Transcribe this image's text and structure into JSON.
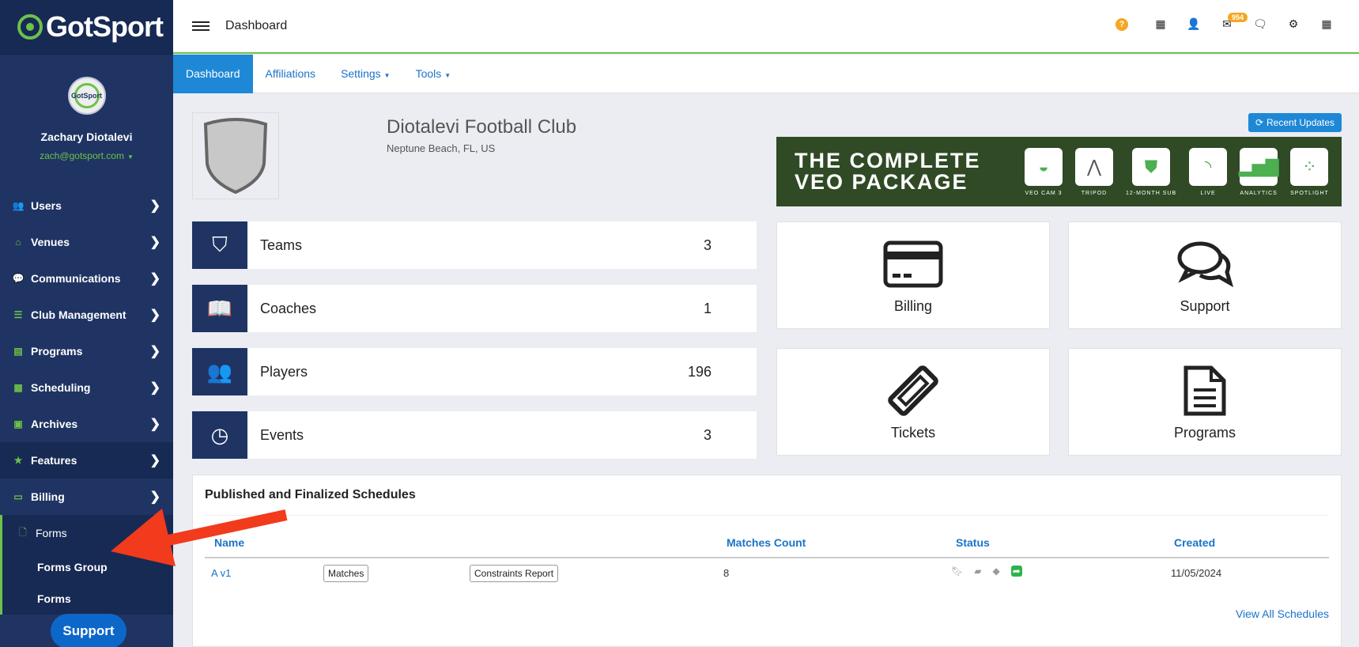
{
  "app": {
    "logo_text": "GotSport",
    "top_title": "Dashboard",
    "mail_badge": "954"
  },
  "user": {
    "name": "Zachary Diotalevi",
    "email": "zach@gotsport.com",
    "avatar_text": "GotSport"
  },
  "sidebar": {
    "items": [
      {
        "label": "Users",
        "icon": "users-icon"
      },
      {
        "label": "Venues",
        "icon": "home-icon"
      },
      {
        "label": "Communications",
        "icon": "chat-icon"
      },
      {
        "label": "Club Management",
        "icon": "list-icon"
      },
      {
        "label": "Programs",
        "icon": "document-icon"
      },
      {
        "label": "Scheduling",
        "icon": "calendar-icon"
      },
      {
        "label": "Archives",
        "icon": "archive-icon"
      },
      {
        "label": "Features",
        "icon": "star-icon"
      },
      {
        "label": "Billing",
        "icon": "credit-card-icon"
      }
    ],
    "forms": {
      "label": "Forms",
      "sub": [
        "Forms Group",
        "Forms"
      ]
    },
    "support_label": "Support"
  },
  "tabs": [
    "Dashboard",
    "Affiliations",
    "Settings",
    "Tools"
  ],
  "club": {
    "name": "Diotalevi Football Club",
    "location": "Neptune Beach, FL, US",
    "recent_updates": "Recent Updates"
  },
  "veo": {
    "headline_1": "THE COMPLETE",
    "headline_2": "VEO PACKAGE",
    "items": [
      "VEO CAM 3",
      "TRIPOD",
      "12-MONTH SUB",
      "LIVE",
      "ANALYTICS",
      "SPOTLIGHT"
    ]
  },
  "stats": [
    {
      "label": "Teams",
      "value": "3"
    },
    {
      "label": "Coaches",
      "value": "1"
    },
    {
      "label": "Players",
      "value": "196"
    },
    {
      "label": "Events",
      "value": "3"
    }
  ],
  "cards": [
    "Billing",
    "Support",
    "Tickets",
    "Programs"
  ],
  "schedules": {
    "title": "Published and Finalized Schedules",
    "headers": [
      "Name",
      "Matches Count",
      "Status",
      "Created"
    ],
    "rows": [
      {
        "name": "A v1",
        "matches_btn": "Matches",
        "constraints_btn": "Constraints Report",
        "count": "8",
        "created": "11/05/2024"
      }
    ],
    "view_all": "View All Schedules"
  },
  "colors": {
    "sidebar": "#1f3463",
    "accent_green": "#6cc24a",
    "link_blue": "#1a73c9",
    "arrow_red": "#f23a1d"
  }
}
